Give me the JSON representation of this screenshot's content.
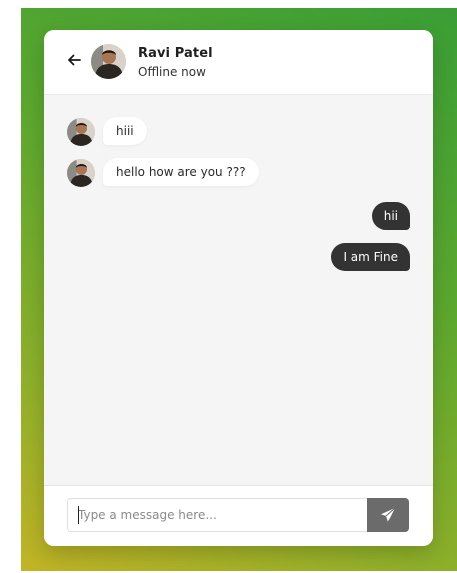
{
  "header": {
    "name": "Ravi Patel",
    "status": "Offline now",
    "back_icon": "arrow-left-icon"
  },
  "messages": [
    {
      "direction": "incoming",
      "text": "hiii"
    },
    {
      "direction": "incoming",
      "text": "hello how are you ???"
    },
    {
      "direction": "outgoing",
      "text": "hii"
    },
    {
      "direction": "outgoing",
      "text": "I am Fine"
    }
  ],
  "composer": {
    "placeholder": "Type a message here...",
    "value": "",
    "send_icon": "paper-plane-icon"
  },
  "colors": {
    "gradient_top": "#3a9e35",
    "gradient_bottom": "#c2b425",
    "outgoing_bubble": "#333333",
    "send_button": "#6b6b6b"
  }
}
